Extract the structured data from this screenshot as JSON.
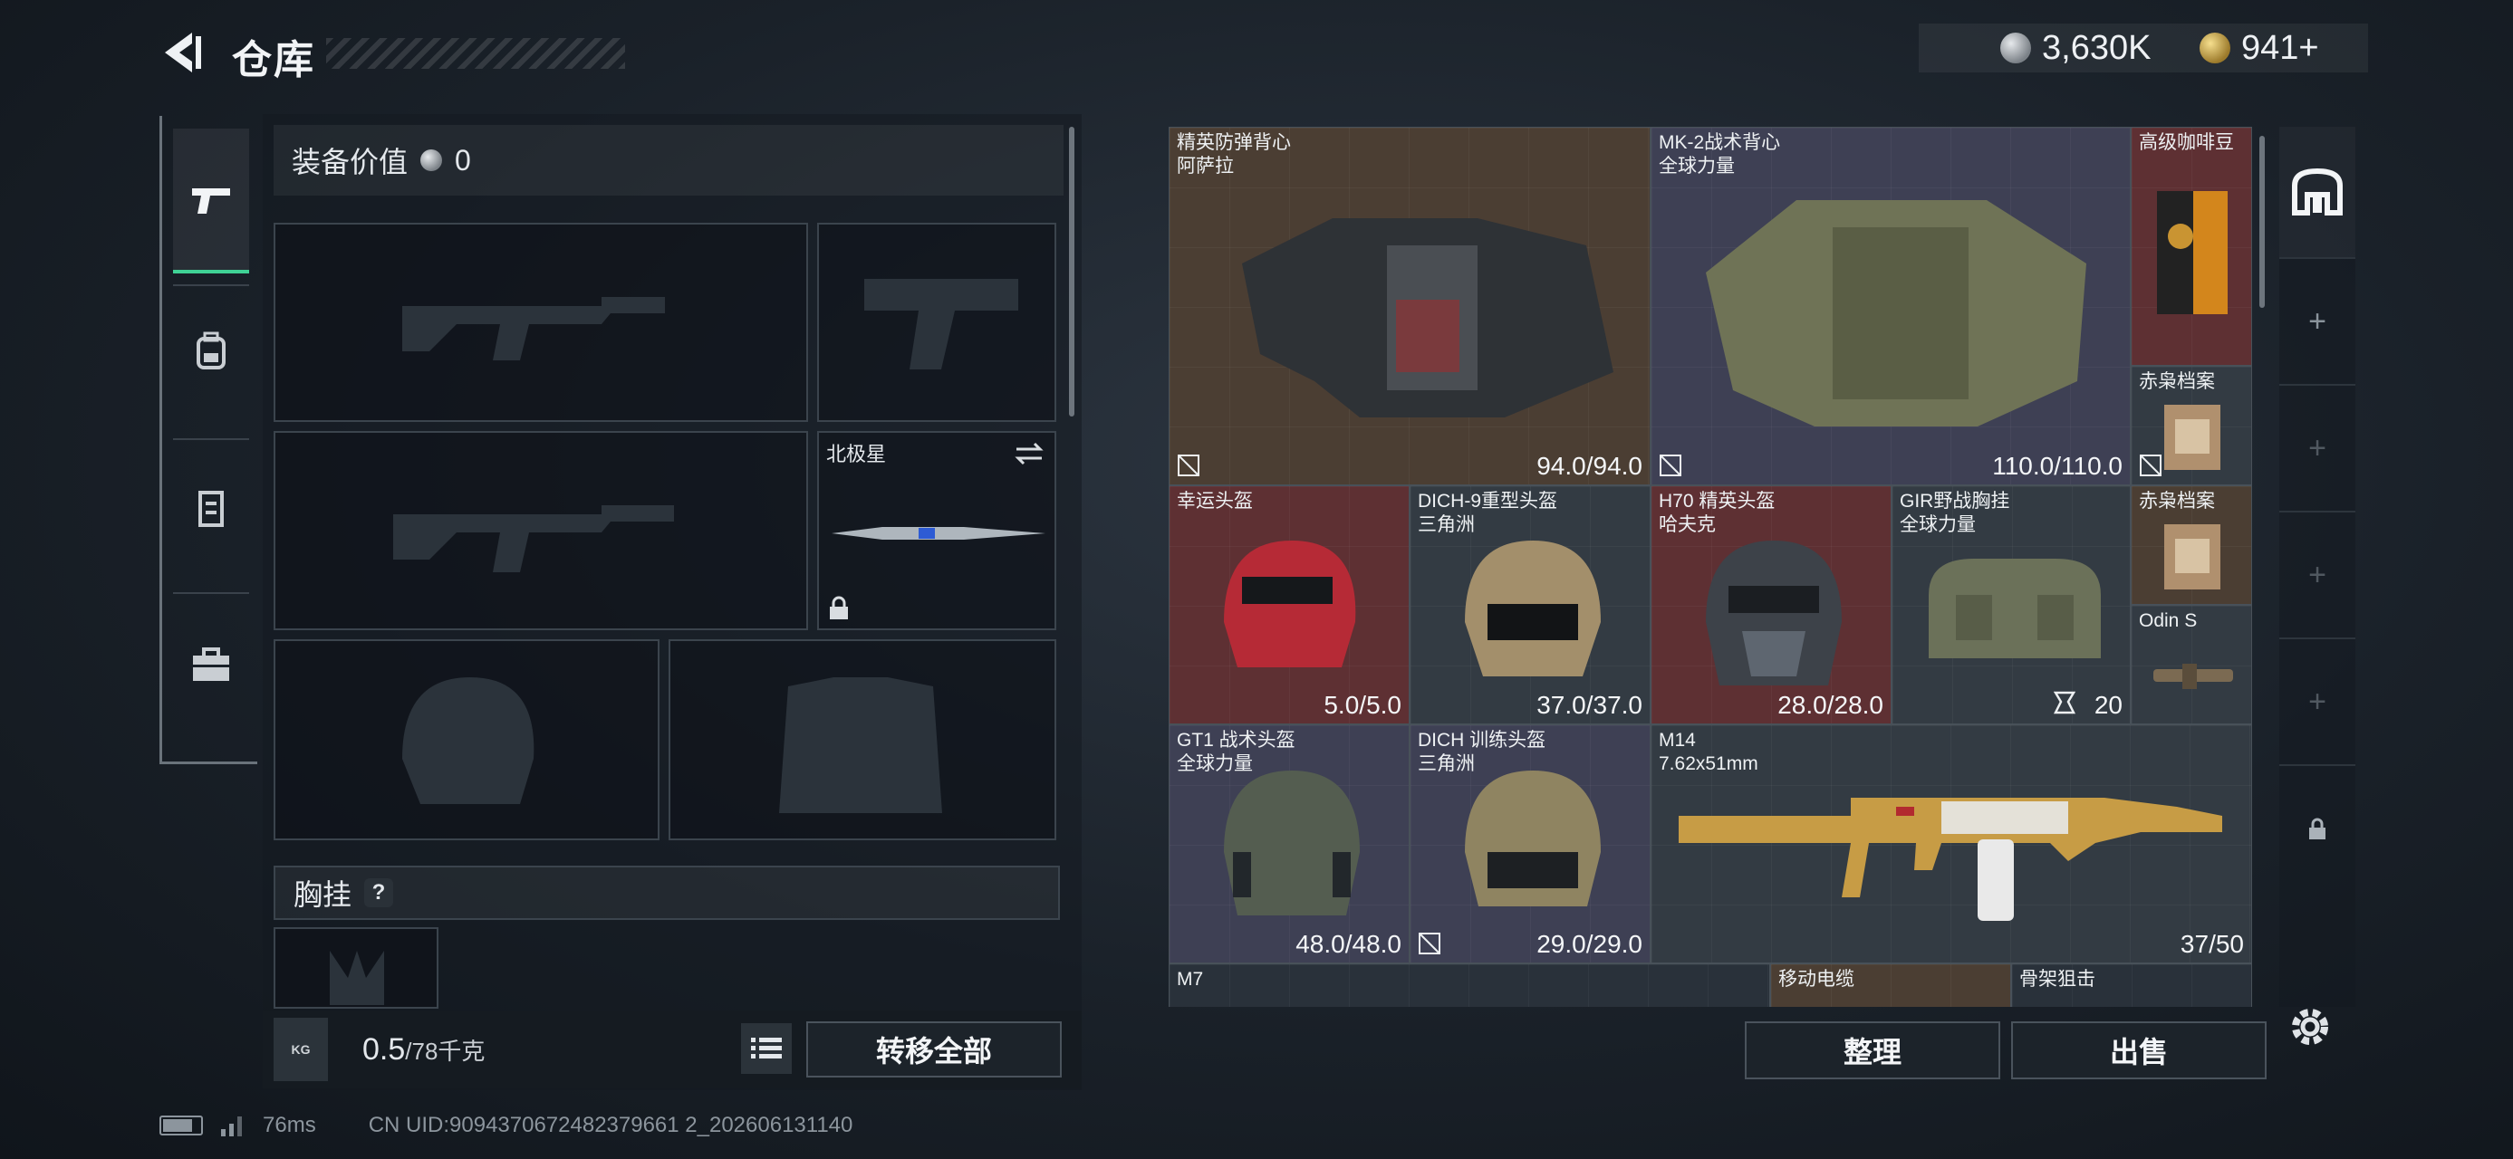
{
  "header": {
    "title": "仓库",
    "currencies": [
      {
        "icon": "silver-coin-icon",
        "value": "3,630K"
      },
      {
        "icon": "gold-coin-icon",
        "value": "941+"
      }
    ]
  },
  "left_nav": {
    "items": [
      {
        "icon": "pistol-icon",
        "active": true
      },
      {
        "icon": "backpack-icon",
        "active": false
      },
      {
        "icon": "vest-icon",
        "active": false
      },
      {
        "icon": "briefcase-icon",
        "active": false
      }
    ]
  },
  "equipment": {
    "value_label": "装备价值",
    "value": "0",
    "melee_slot": {
      "name": "北极星",
      "locked": true
    },
    "chest_rig_label": "胸挂",
    "help": "?",
    "weight_current": "0.5",
    "weight_max": "/78千克",
    "kg_label": "KG",
    "transfer_all": "转移全部"
  },
  "stash_items": [
    {
      "id": "elite-vest",
      "line1": "精英防弹背心",
      "line2": "阿萨拉",
      "value": "94.0/94.0",
      "mark": true
    },
    {
      "id": "mk2-vest",
      "line1": "MK-2战术背心",
      "line2": "全球力量",
      "value": "110.0/110.0",
      "mark": true
    },
    {
      "id": "coffee",
      "line1": "高级咖啡豆",
      "line2": "",
      "value": ""
    },
    {
      "id": "owl-file-1",
      "line1": "赤枭档案",
      "line2": "",
      "value": "",
      "mark": true
    },
    {
      "id": "lucky-helmet",
      "line1": "幸运头盔",
      "line2": "",
      "value": "5.0/5.0"
    },
    {
      "id": "dich9-helmet",
      "line1": "DICH-9重型头盔",
      "line2": "三角洲",
      "value": "37.0/37.0"
    },
    {
      "id": "h70-helmet",
      "line1": "H70 精英头盔",
      "line2": "哈夫克",
      "value": "28.0/28.0"
    },
    {
      "id": "gir-rig",
      "line1": "GIR野战胸挂",
      "line2": "全球力量",
      "value": "20"
    },
    {
      "id": "owl-file-2",
      "line1": "赤枭档案",
      "line2": "",
      "value": ""
    },
    {
      "id": "odin-scope",
      "line1": "Odin S",
      "line2": "",
      "value": ""
    },
    {
      "id": "gt1-helmet",
      "line1": "GT1 战术头盔",
      "line2": "全球力量",
      "value": "48.0/48.0"
    },
    {
      "id": "dich-train-helmet",
      "line1": "DICH 训练头盔",
      "line2": "三角洲",
      "value": "29.0/29.0",
      "mark": true
    },
    {
      "id": "m14-rifle",
      "line1": "M14",
      "line2": "7.62x51mm",
      "value": "37/50"
    },
    {
      "id": "m7-rifle",
      "line1": "M7",
      "line2": "",
      "value": ""
    },
    {
      "id": "mobile-cable",
      "line1": "移动电缆",
      "line2": "",
      "value": ""
    },
    {
      "id": "skeleton-sniper",
      "line1": "骨架狙击",
      "line2": "",
      "value": ""
    }
  ],
  "stash_actions": {
    "organize": "整理",
    "sell": "出售"
  },
  "side_panel": {
    "add_label": "+"
  },
  "footer": {
    "ping": "76ms",
    "uid": "CN UID:9094370672482379661 2_202606131140"
  }
}
